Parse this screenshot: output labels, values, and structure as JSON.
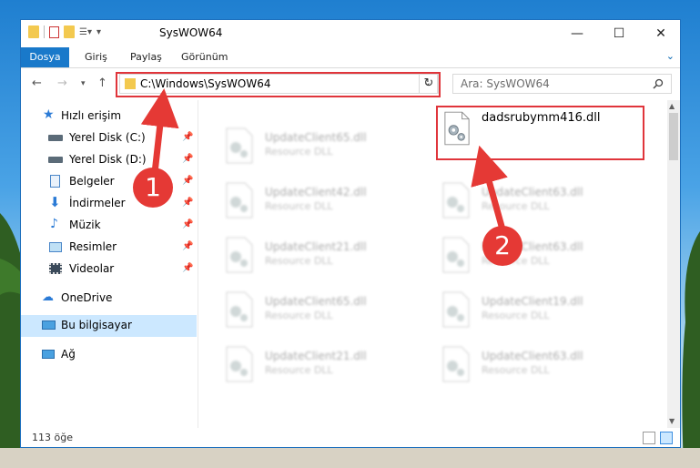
{
  "window": {
    "title": "SysWOW64"
  },
  "ribbon": {
    "tabs": [
      "Dosya",
      "Giriş",
      "Paylaş",
      "Görünüm"
    ]
  },
  "address": {
    "path": "C:\\Windows\\SysWOW64"
  },
  "search": {
    "placeholder": "Ara: SysWOW64"
  },
  "sidebar": {
    "items": [
      {
        "label": "Hızlı erişim"
      },
      {
        "label": "Yerel Disk (C:)"
      },
      {
        "label": "Yerel Disk (D:)"
      },
      {
        "label": "Belgeler"
      },
      {
        "label": "İndirmeler"
      },
      {
        "label": "Müzik"
      },
      {
        "label": "Resimler"
      },
      {
        "label": "Videolar"
      },
      {
        "label": "OneDrive"
      },
      {
        "label": "Bu bilgisayar"
      },
      {
        "label": "Ağ"
      }
    ]
  },
  "files": {
    "left": [
      {
        "name": "UpdateClient65.dll",
        "type": "Resource DLL"
      },
      {
        "name": "UpdateClient42.dll",
        "type": "Resource DLL"
      },
      {
        "name": "UpdateClient21.dll",
        "type": "Resource DLL"
      },
      {
        "name": "UpdateClient65.dll",
        "type": "Resource DLL"
      },
      {
        "name": "UpdateClient21.dll",
        "type": "Resource DLL"
      }
    ],
    "right": [
      {
        "name": "UpdateClient63.dll",
        "type": "Resource DLL"
      },
      {
        "name": "UpdateClient63.dll",
        "type": "Resource DLL"
      },
      {
        "name": "UpdateClient19.dll",
        "type": "Resource DLL"
      },
      {
        "name": "UpdateClient63.dll",
        "type": "Resource DLL"
      }
    ],
    "highlighted": {
      "name": "dadsrubymm416.dll"
    }
  },
  "status": {
    "count": "113 öğe"
  },
  "annotations": {
    "step1": "1",
    "step2": "2"
  },
  "colors": {
    "accent": "#1979ca",
    "annotation": "#e53935",
    "selection": "#cce8ff"
  }
}
